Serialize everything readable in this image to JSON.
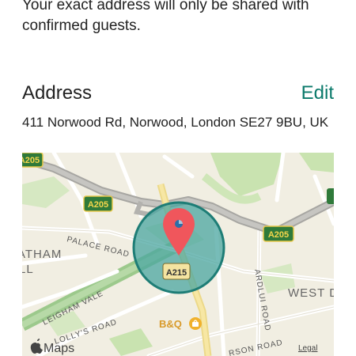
{
  "listing": {
    "privacy_note": "Your exact address will only be shared with confirmed guests."
  },
  "address_section": {
    "title": "Address",
    "edit_label": "Edit",
    "address": "411 Norwood Rd, Norwood, London SE27 9BU, UK"
  },
  "map": {
    "provider_label": "Maps",
    "legal_label": "Legal",
    "road_shields": [
      "A205",
      "A205",
      "A205",
      "A215"
    ],
    "street_labels": {
      "palace_road": "PALACE ROAD",
      "leigham_vale": "LEIGHAM VALE",
      "lollys_road": "LOLLY'S ROAD",
      "ardlui_road": "ARDLUI ROAD",
      "robson_road": "RSON ROAD"
    },
    "area_labels": {
      "west_d": "WEST D",
      "atham": "ATHAM",
      "ll": "LL"
    },
    "poi_label": "B&Q",
    "colors": {
      "accent": "#0b7a6b",
      "pin": "#f0565c",
      "radius_fill": "#4aa6a0",
      "shield_bg": "#2f7a3a",
      "land": "#f1eee2",
      "park": "#c9e3b0"
    }
  }
}
